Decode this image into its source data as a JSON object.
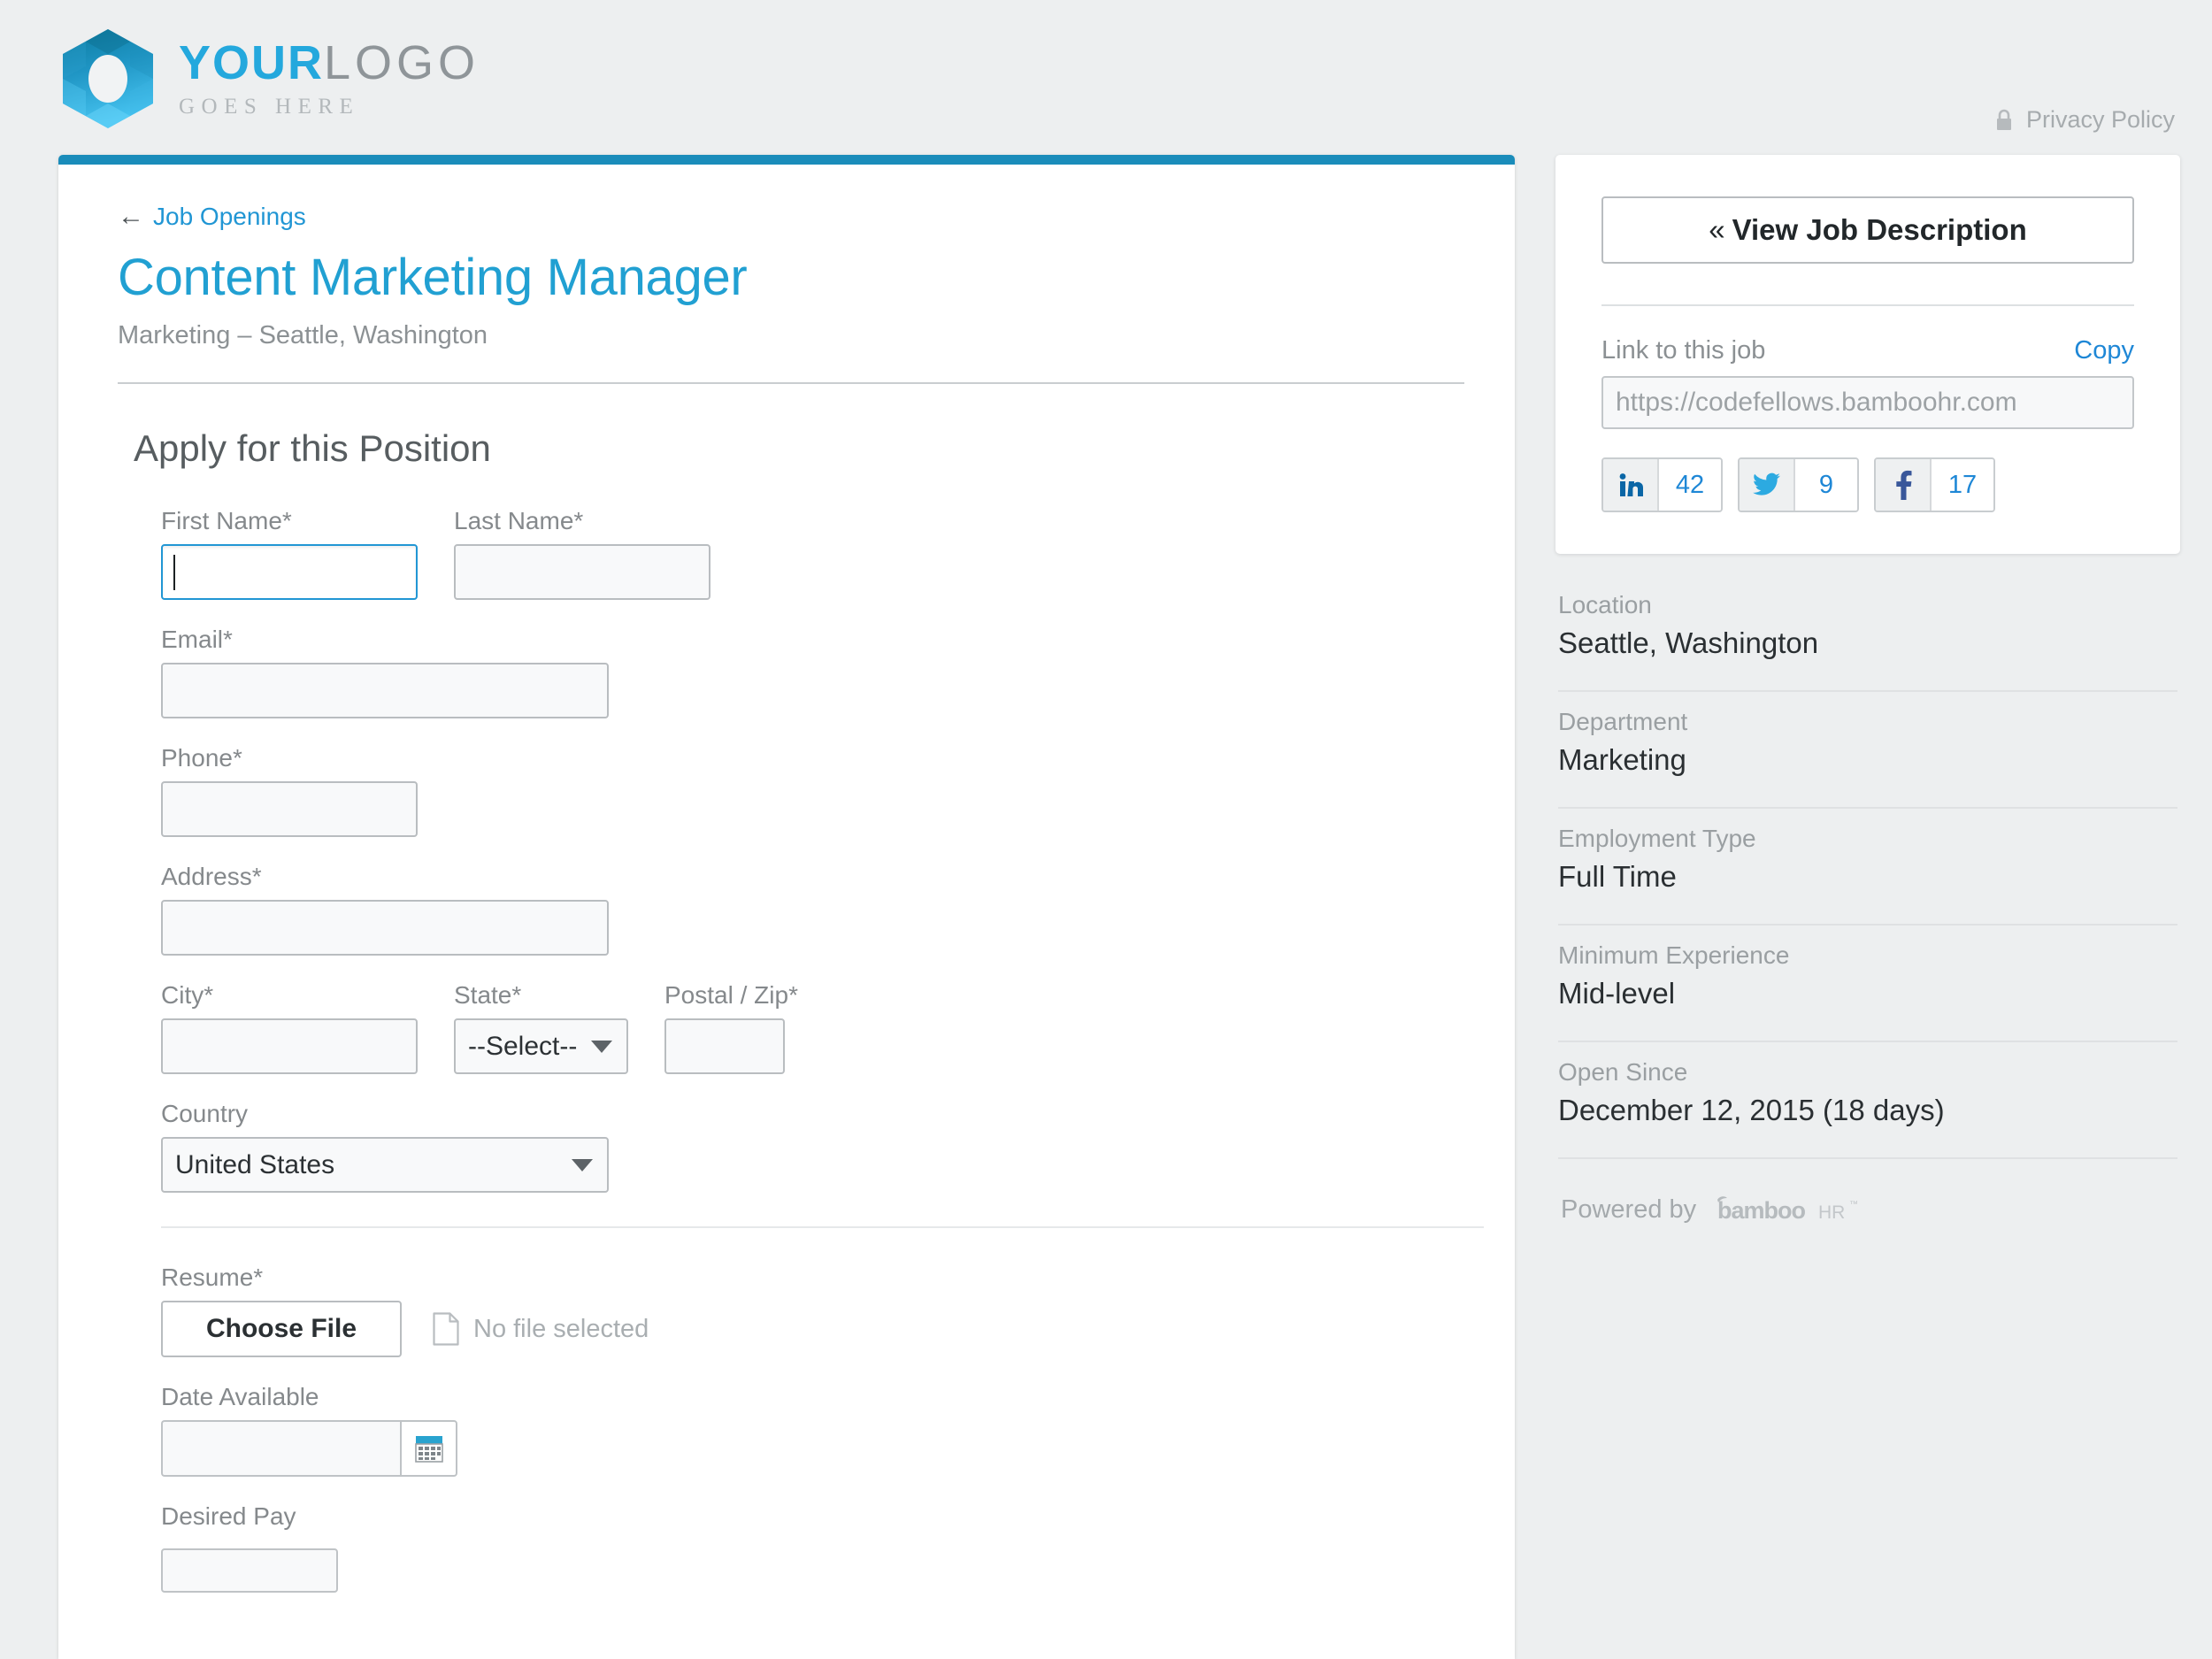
{
  "header": {
    "logo": {
      "word1": "YOUR",
      "word2": "LOGO",
      "tagline": "GOES HERE"
    },
    "privacy_policy": "Privacy Policy"
  },
  "main": {
    "back_link": "Job Openings",
    "back_arrow": "←",
    "job_title": "Content Marketing Manager",
    "job_subtitle": "Marketing – Seattle, Washington",
    "section_title": "Apply for this Position",
    "fields": {
      "first_name": {
        "label": "First Name",
        "required": "*",
        "value": ""
      },
      "last_name": {
        "label": "Last Name",
        "required": "*",
        "value": ""
      },
      "email": {
        "label": "Email",
        "required": "*",
        "value": ""
      },
      "phone": {
        "label": "Phone",
        "required": "*",
        "value": ""
      },
      "address": {
        "label": "Address",
        "required": "*",
        "value": ""
      },
      "city": {
        "label": "City",
        "required": "*",
        "value": ""
      },
      "state": {
        "label": "State",
        "required": "*",
        "selected": "--Select--"
      },
      "postal_zip": {
        "label": "Postal / Zip",
        "required": "*",
        "value": ""
      },
      "country": {
        "label": "Country",
        "required": "",
        "selected": "United States"
      },
      "resume": {
        "label": "Resume",
        "required": "*",
        "button": "Choose File",
        "status": "No file selected"
      },
      "date_available": {
        "label": "Date Available",
        "required": "",
        "value": ""
      },
      "desired_pay": {
        "label": "Desired Pay",
        "required": "",
        "value": ""
      }
    }
  },
  "sidebar": {
    "view_job_description": "View Job Description",
    "view_job_chevron": "«",
    "link_label": "Link to this job",
    "copy_label": "Copy",
    "job_url": "https://codefellows.bamboohr.com",
    "social": [
      {
        "network": "linkedin",
        "count": "42"
      },
      {
        "network": "twitter",
        "count": "9"
      },
      {
        "network": "facebook",
        "count": "17"
      }
    ],
    "details": [
      {
        "label": "Location",
        "value": "Seattle, Washington"
      },
      {
        "label": "Department",
        "value": "Marketing"
      },
      {
        "label": "Employment Type",
        "value": "Full Time"
      },
      {
        "label": "Minimum Experience",
        "value": "Mid-level"
      },
      {
        "label": "Open Since",
        "value": "December 12, 2015 (18 days)"
      }
    ],
    "powered_by": "Powered by",
    "powered_brand": "bambooHR"
  },
  "colors": {
    "accent_blue": "#1a8cba",
    "title_blue": "#21a0d2",
    "link_blue": "#2196d4",
    "page_bg": "#edeff0"
  }
}
